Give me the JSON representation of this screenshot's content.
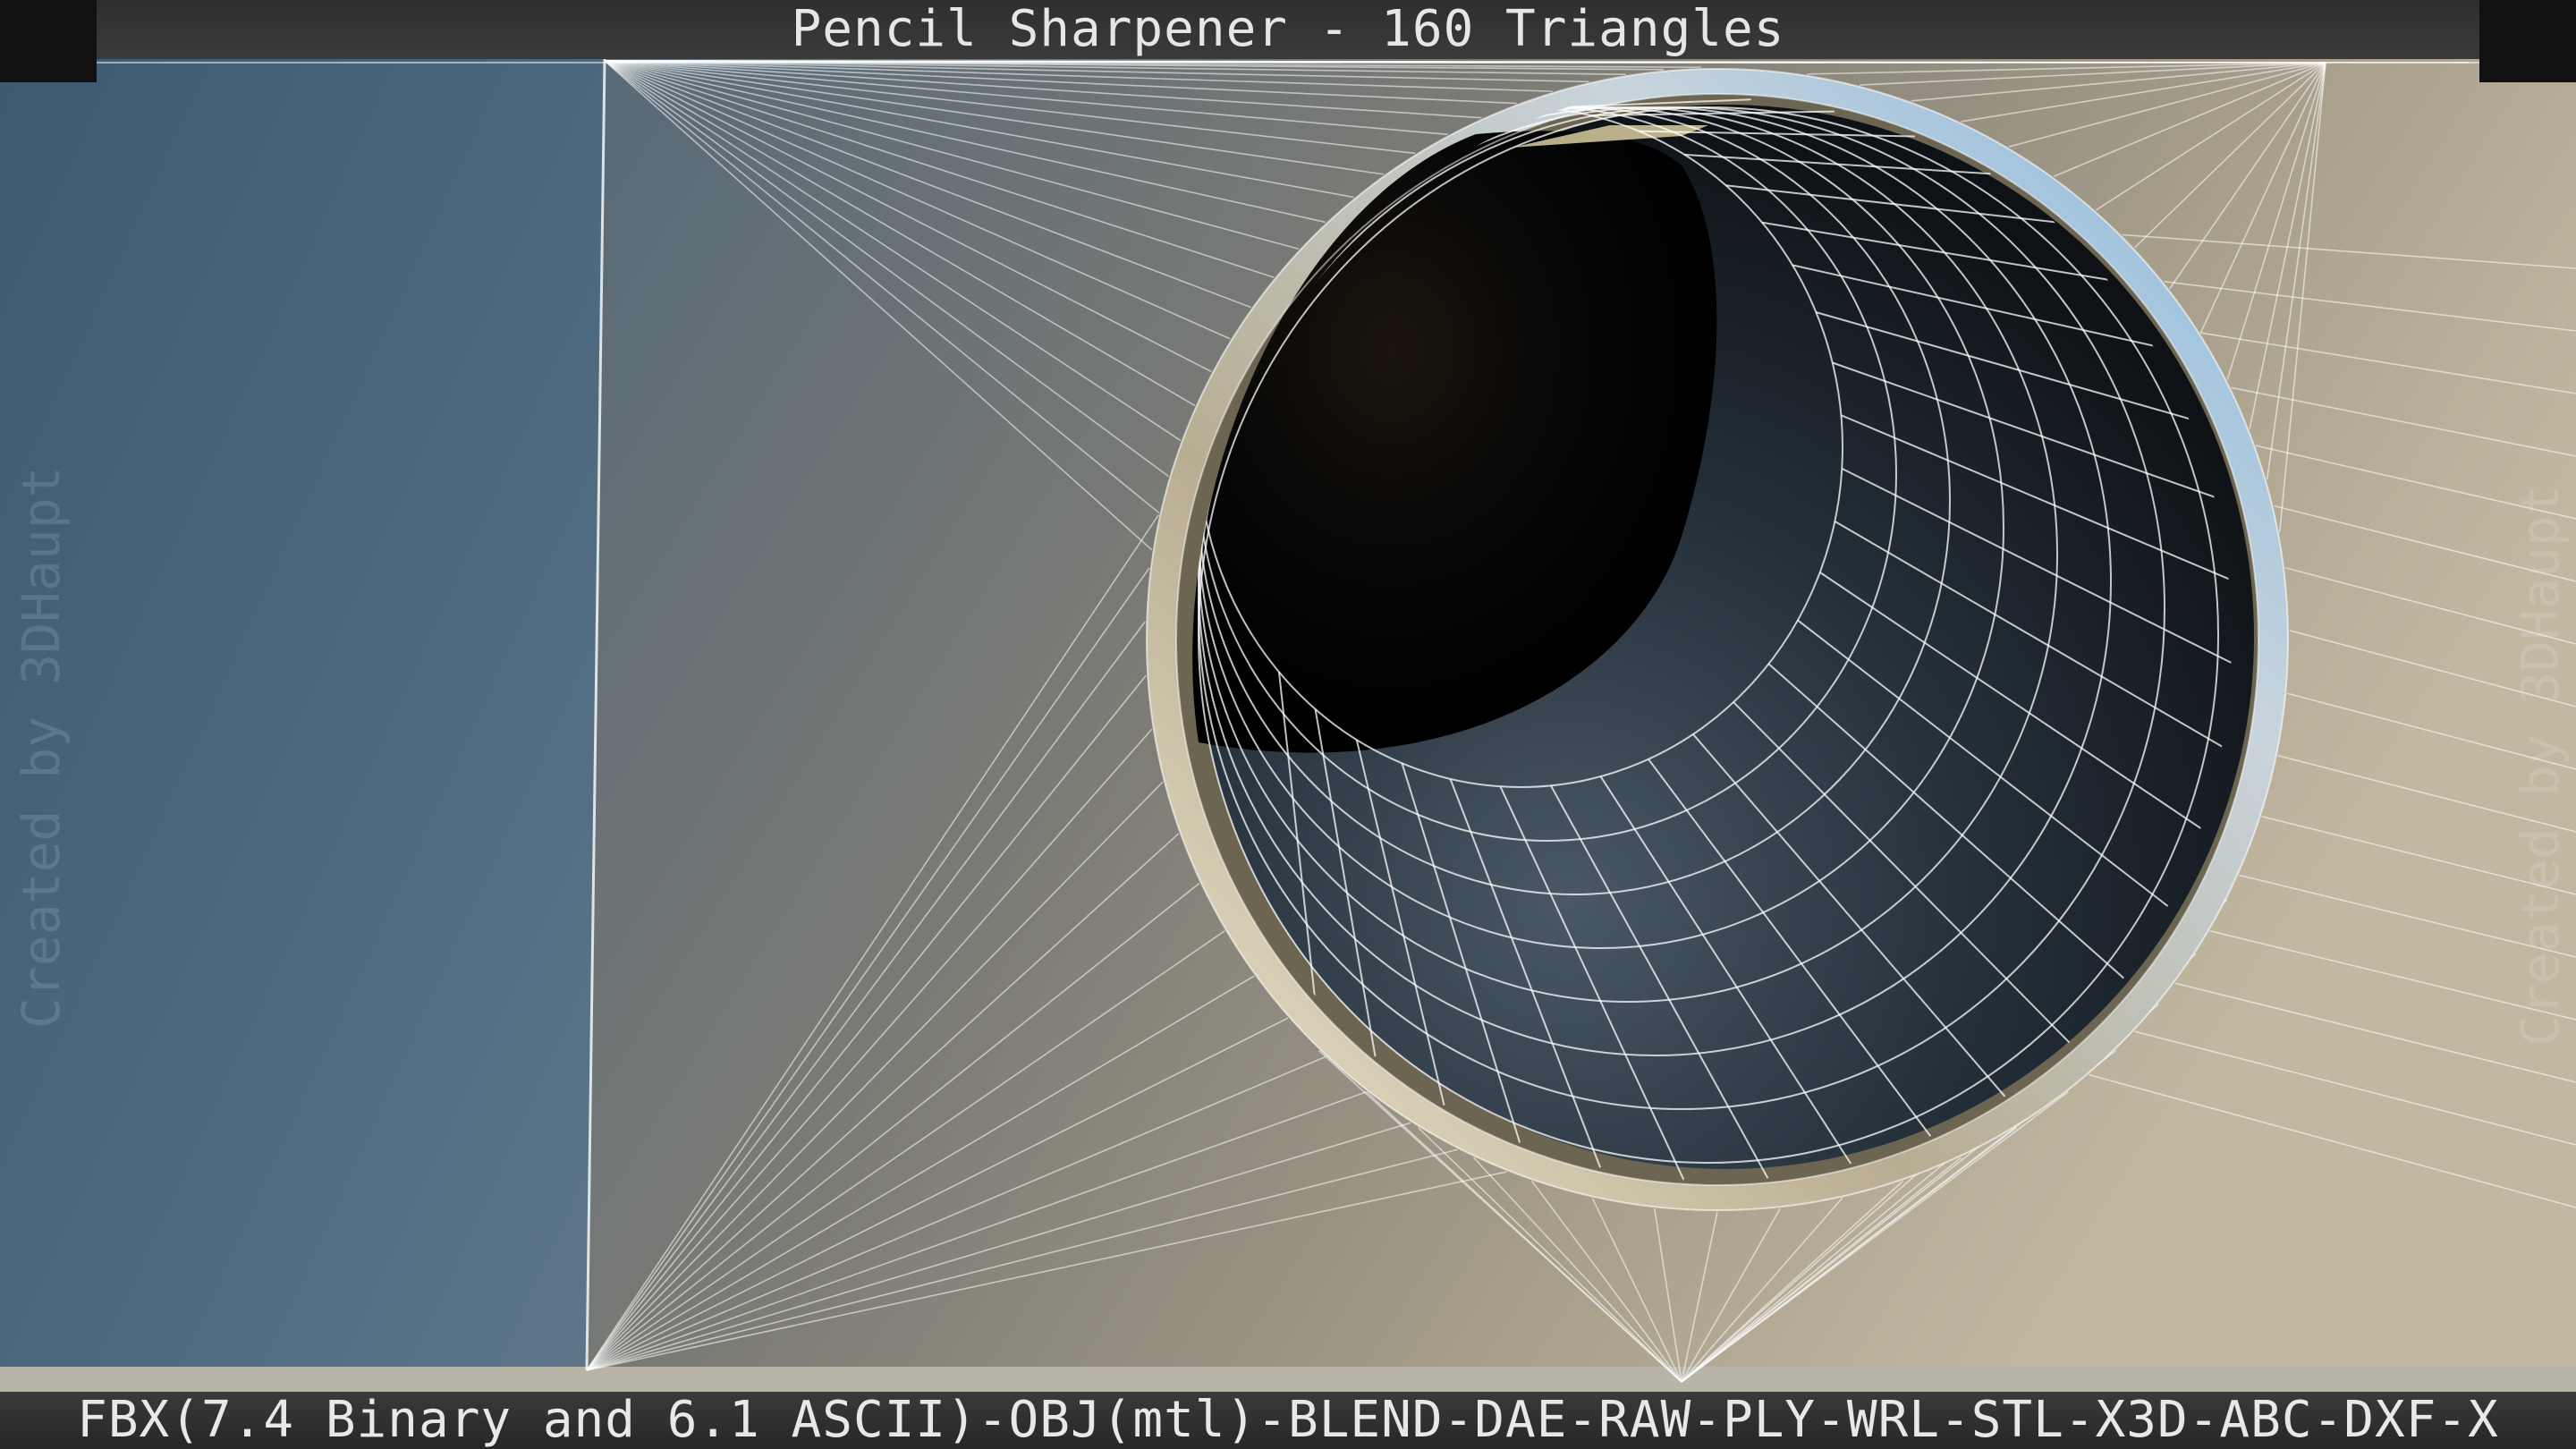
{
  "header": {
    "title": "Pencil Sharpener - 160 Triangles"
  },
  "footer": {
    "formats": "FBX(7.4 Binary and 6.1 ASCII)-OBJ(mtl)-BLEND-DAE-RAW-PLY-WRL-STL-X3D-ABC-DXF-X"
  },
  "watermarks": {
    "left": "Created by 3DHaupt",
    "right": "Created by 3DHaupt"
  },
  "scene": {
    "subject": "wireframe-render",
    "colors": {
      "wire": "#ffffff",
      "surface_light": "#bdb4a0",
      "surface_dark": "#3d5566",
      "hole_interior": "#0a0a0a"
    }
  }
}
